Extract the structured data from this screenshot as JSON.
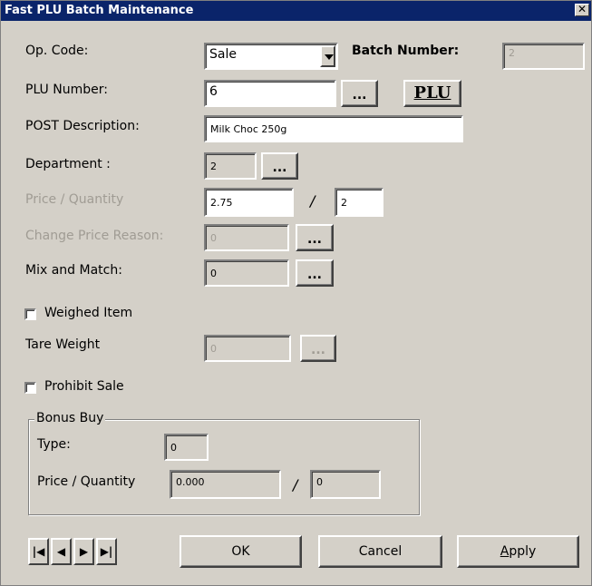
{
  "window": {
    "title": "Fast PLU Batch Maintenance",
    "close_glyph": "✕"
  },
  "op_code": {
    "label": "Op. Code:",
    "value": "Sale"
  },
  "batch_number": {
    "label": "Batch Number:",
    "value": "2"
  },
  "plu_number": {
    "label": "PLU Number:",
    "value": "6",
    "browse_label": "...",
    "plu_button_label": "PLU"
  },
  "post_description": {
    "label": "POST Description:",
    "value": "Milk Choc 250g"
  },
  "department": {
    "label": "Department :",
    "value": "2",
    "browse_label": "..."
  },
  "price_quantity": {
    "label": "Price / Quantity",
    "price": "2.75",
    "separator": "/",
    "quantity": "2"
  },
  "change_price_reason": {
    "label": "Change Price Reason:",
    "value": "0",
    "browse_label": "..."
  },
  "mix_and_match": {
    "label": "Mix and Match:",
    "value": "0",
    "browse_label": "..."
  },
  "weighed_item": {
    "label": "Weighed Item",
    "checked": false
  },
  "tare_weight": {
    "label": "Tare Weight",
    "value": "0",
    "browse_label": "..."
  },
  "prohibit_sale": {
    "label": "Prohibit Sale",
    "checked": false
  },
  "bonus_buy": {
    "group_label": "Bonus Buy",
    "type_label": "Type:",
    "type_value": "0",
    "price_quantity_label": "Price / Quantity",
    "price_value": "0.000",
    "separator": "/",
    "quantity_value": "0"
  },
  "navigation": {
    "first": "|◀",
    "prev": "◀",
    "next": "▶",
    "last": "▶|"
  },
  "buttons": {
    "ok": "OK",
    "cancel": "Cancel",
    "apply_prefix": "",
    "apply_underlined": "A",
    "apply_rest": "pply"
  },
  "colors": {
    "titlebar": "#0a246a",
    "face": "#d4d0c8",
    "disabled_text": "#a09c94"
  }
}
